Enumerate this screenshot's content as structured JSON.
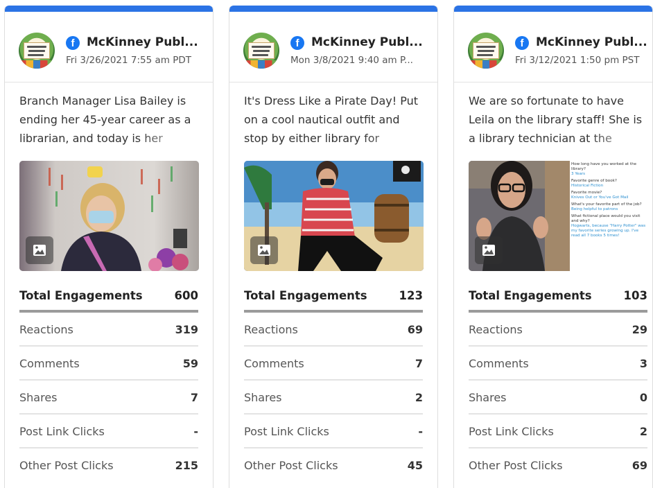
{
  "cards": [
    {
      "page_name": "McKinney Publ...",
      "date": "Fri 3/26/2021 7:55 am PDT",
      "text": "Branch Manager Lisa Bailey is ending her 45-year career as a librarian, and today is her",
      "image_icon": "image-icon",
      "total_label": "Total Engagements",
      "total_value": "600",
      "stats": [
        {
          "label": "Reactions",
          "value": "319"
        },
        {
          "label": "Comments",
          "value": "59"
        },
        {
          "label": "Shares",
          "value": "7"
        },
        {
          "label": "Post Link Clicks",
          "value": "-"
        },
        {
          "label": "Other Post Clicks",
          "value": "215"
        }
      ]
    },
    {
      "page_name": "McKinney Publ...",
      "date": "Mon 3/8/2021 9:40 am P...",
      "text": "It's Dress Like a Pirate Day! Put on a cool nautical outfit and stop by either library for",
      "image_icon": "image-icon",
      "total_label": "Total Engagements",
      "total_value": "123",
      "stats": [
        {
          "label": "Reactions",
          "value": "69"
        },
        {
          "label": "Comments",
          "value": "7"
        },
        {
          "label": "Shares",
          "value": "2"
        },
        {
          "label": "Post Link Clicks",
          "value": "-"
        },
        {
          "label": "Other Post Clicks",
          "value": "45"
        }
      ]
    },
    {
      "page_name": "McKinney Publ...",
      "date": "Fri 3/12/2021 1:50 pm PST",
      "text": "We are so fortunate to have Leila on the library staff! She is a library technician at the",
      "image_icon": "image-icon",
      "total_label": "Total Engagements",
      "total_value": "103",
      "image_text": [
        "How long have you worked at the library?",
        "3 Years",
        "Favorite genre of book?",
        "Historical Fiction",
        "Favorite movie?",
        "Knives Out or You've Got Mail",
        "What's your favorite part of the job?",
        "Being helpful to patrons",
        "What fictional place would you visit and why?",
        "Hogwarts, because \"Harry Potter\" was my favorite series growing up. I've read all 7 books 5 times!"
      ],
      "stats": [
        {
          "label": "Reactions",
          "value": "29"
        },
        {
          "label": "Comments",
          "value": "3"
        },
        {
          "label": "Shares",
          "value": "0"
        },
        {
          "label": "Post Link Clicks",
          "value": "2"
        },
        {
          "label": "Other Post Clicks",
          "value": "69"
        }
      ]
    }
  ],
  "colors": {
    "accent_bar": "#2b73e5",
    "facebook_blue": "#1877f2"
  },
  "avatar": "mckinney-public-library-logo",
  "network_icon": "facebook-icon"
}
